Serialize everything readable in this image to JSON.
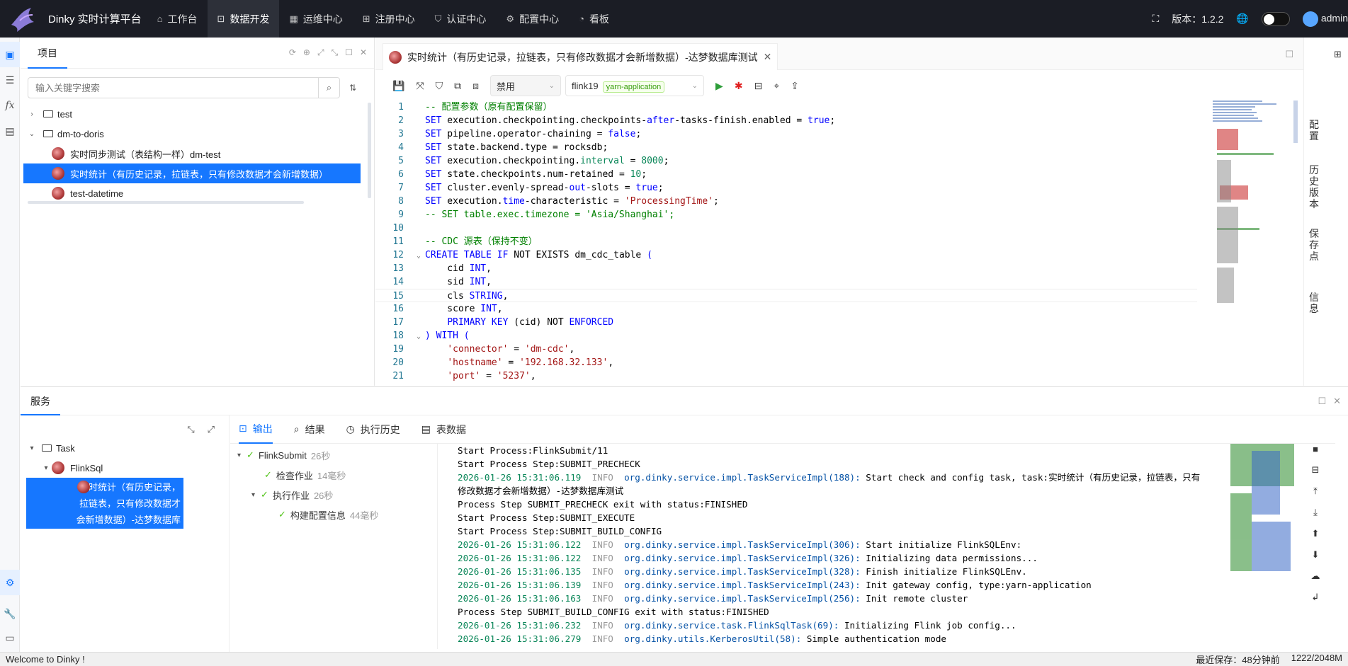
{
  "header": {
    "brand": "Dinky 实时计算平台",
    "nav": [
      {
        "label": "工作台",
        "icon": "home-icon"
      },
      {
        "label": "数据开发",
        "icon": "terminal-icon",
        "active": true
      },
      {
        "label": "运维中心",
        "icon": "calendar-icon"
      },
      {
        "label": "注册中心",
        "icon": "grid-icon"
      },
      {
        "label": "认证中心",
        "icon": "shield-icon"
      },
      {
        "label": "配置中心",
        "icon": "gear-icon"
      },
      {
        "label": "看板",
        "icon": "dashboard-icon"
      }
    ],
    "version": "版本：1.2.2",
    "user": "admin"
  },
  "project": {
    "title": "项目",
    "search_placeholder": "输入关键字搜索",
    "tree": [
      {
        "label": "test",
        "type": "folder",
        "level": 0,
        "caret": "›"
      },
      {
        "label": "dm-to-doris",
        "type": "folder",
        "level": 0,
        "caret": "⌄"
      },
      {
        "label": "实时同步测试（表结构一样）dm-test",
        "type": "task",
        "level": 1
      },
      {
        "label": "实时统计（有历史记录，拉链表，只有修改数据才会新增数据）",
        "type": "task",
        "level": 1,
        "selected": true
      },
      {
        "label": "test-datetime",
        "type": "task",
        "level": 1
      }
    ]
  },
  "editor": {
    "tab_label": "实时统计（有历史记录，拉链表，只有修改数据才会新增数据）-达梦数据库测试",
    "toolbar": {
      "select_label": "禁用",
      "cluster": "flink19",
      "mode_tag": "yarn-application"
    },
    "lines": [
      [
        {
          "c": "cm",
          "t": "-- 配置参数（原有配置保留）"
        }
      ],
      [
        {
          "c": "kw",
          "t": "SET"
        },
        {
          "c": "tx",
          "t": " execution.checkpointing.checkpoints-"
        },
        {
          "c": "kw",
          "t": "after"
        },
        {
          "c": "tx",
          "t": "-tasks-finish.enabled = "
        },
        {
          "c": "kw",
          "t": "true"
        },
        {
          "c": "tx",
          "t": ";"
        }
      ],
      [
        {
          "c": "kw",
          "t": "SET"
        },
        {
          "c": "tx",
          "t": " pipeline.operator-chaining = "
        },
        {
          "c": "kw",
          "t": "false"
        },
        {
          "c": "tx",
          "t": ";"
        }
      ],
      [
        {
          "c": "kw",
          "t": "SET"
        },
        {
          "c": "tx",
          "t": " state.backend.type = rocksdb;"
        }
      ],
      [
        {
          "c": "kw",
          "t": "SET"
        },
        {
          "c": "tx",
          "t": " execution.checkpointing."
        },
        {
          "c": "nu",
          "t": "interval"
        },
        {
          "c": "tx",
          "t": " = "
        },
        {
          "c": "nu",
          "t": "8000"
        },
        {
          "c": "tx",
          "t": ";"
        }
      ],
      [
        {
          "c": "kw",
          "t": "SET"
        },
        {
          "c": "tx",
          "t": " state.checkpoints.num-retained = "
        },
        {
          "c": "nu",
          "t": "10"
        },
        {
          "c": "tx",
          "t": ";"
        }
      ],
      [
        {
          "c": "kw",
          "t": "SET"
        },
        {
          "c": "tx",
          "t": " cluster.evenly-spread-"
        },
        {
          "c": "kw",
          "t": "out"
        },
        {
          "c": "tx",
          "t": "-slots = "
        },
        {
          "c": "kw",
          "t": "true"
        },
        {
          "c": "tx",
          "t": ";"
        }
      ],
      [
        {
          "c": "kw",
          "t": "SET"
        },
        {
          "c": "tx",
          "t": " execution."
        },
        {
          "c": "kw",
          "t": "time"
        },
        {
          "c": "tx",
          "t": "-characteristic = "
        },
        {
          "c": "st",
          "t": "'ProcessingTime'"
        },
        {
          "c": "tx",
          "t": ";"
        }
      ],
      [
        {
          "c": "cm",
          "t": "-- SET table.exec.timezone = 'Asia/Shanghai';"
        }
      ],
      [],
      [
        {
          "c": "cm",
          "t": "-- CDC 源表（保持不变）"
        }
      ],
      [
        {
          "c": "kw",
          "t": "CREATE TABLE IF"
        },
        {
          "c": "tx",
          "t": " NOT EXISTS dm_cdc_table "
        },
        {
          "c": "kw",
          "t": "("
        }
      ],
      [
        {
          "c": "tx",
          "t": "    cid "
        },
        {
          "c": "kw",
          "t": "INT"
        },
        {
          "c": "tx",
          "t": ","
        }
      ],
      [
        {
          "c": "tx",
          "t": "    sid "
        },
        {
          "c": "kw",
          "t": "INT"
        },
        {
          "c": "tx",
          "t": ","
        }
      ],
      [
        {
          "c": "tx",
          "t": "    cls "
        },
        {
          "c": "kw",
          "t": "STRING"
        },
        {
          "c": "tx",
          "t": ","
        }
      ],
      [
        {
          "c": "tx",
          "t": "    score "
        },
        {
          "c": "kw",
          "t": "INT"
        },
        {
          "c": "tx",
          "t": ","
        }
      ],
      [
        {
          "c": "tx",
          "t": "    "
        },
        {
          "c": "kw",
          "t": "PRIMARY KEY"
        },
        {
          "c": "tx",
          "t": " (cid) NOT "
        },
        {
          "c": "kw",
          "t": "ENFORCED"
        }
      ],
      [
        {
          "c": "kw",
          "t": ")"
        },
        {
          "c": "tx",
          "t": " "
        },
        {
          "c": "kw",
          "t": "WITH ("
        }
      ],
      [
        {
          "c": "tx",
          "t": "    "
        },
        {
          "c": "st",
          "t": "'connector'"
        },
        {
          "c": "tx",
          "t": " = "
        },
        {
          "c": "st",
          "t": "'dm-cdc'"
        },
        {
          "c": "tx",
          "t": ","
        }
      ],
      [
        {
          "c": "tx",
          "t": "    "
        },
        {
          "c": "st",
          "t": "'hostname'"
        },
        {
          "c": "tx",
          "t": " = "
        },
        {
          "c": "st",
          "t": "'192.168.32.133'"
        },
        {
          "c": "tx",
          "t": ","
        }
      ],
      [
        {
          "c": "tx",
          "t": "    "
        },
        {
          "c": "st",
          "t": "'port'"
        },
        {
          "c": "tx",
          "t": " = "
        },
        {
          "c": "st",
          "t": "'5237'"
        },
        {
          "c": "tx",
          "t": ","
        }
      ]
    ],
    "line_numbers": [
      "1",
      "2",
      "3",
      "4",
      "5",
      "6",
      "7",
      "8",
      "9",
      "10",
      "11",
      "12",
      "13",
      "14",
      "15",
      "16",
      "17",
      "18",
      "19",
      "20",
      "21"
    ],
    "current_line": 15
  },
  "right_rail": [
    "配置",
    "历史版本",
    "保存点",
    "信息"
  ],
  "service": {
    "title": "服务",
    "tree": [
      {
        "label": "Task",
        "level": 0
      },
      {
        "label": "FlinkSql",
        "level": 1
      },
      {
        "label": "实时统计（有历史记录，拉链表，只有修改数据才会新增数据）-达梦数据库测试",
        "level": 2,
        "selected": true
      }
    ],
    "tabs": [
      {
        "label": "输出",
        "icon": "terminal-icon",
        "active": true
      },
      {
        "label": "结果",
        "icon": "search-icon"
      },
      {
        "label": "执行历史",
        "icon": "history-icon"
      },
      {
        "label": "表数据",
        "icon": "table-icon"
      }
    ],
    "steps": [
      {
        "label": "FlinkSubmit",
        "dur": "26秒",
        "level": 0
      },
      {
        "label": "检查作业",
        "dur": "14毫秒",
        "level": 1
      },
      {
        "label": "执行作业",
        "dur": "26秒",
        "level": 1
      },
      {
        "label": "构建配置信息",
        "dur": "44毫秒",
        "level": 2
      }
    ],
    "log": [
      {
        "plain": "Start Process:FlinkSubmit/11"
      },
      {
        "plain": "Start Process Step:SUBMIT_PRECHECK"
      },
      {
        "d": "2026-01-26 15:31:06.119",
        "lv": "INFO",
        "cls": "org.dinky.service.impl.TaskServiceImpl(188):",
        "msg": " Start check and config task, task:实时统计（有历史记录，拉链表，只有"
      },
      {
        "plain": "修改数据才会新增数据）-达梦数据库测试"
      },
      {
        "plain": "Process Step SUBMIT_PRECHECK exit with status:FINISHED"
      },
      {
        "plain": "Start Process Step:SUBMIT_EXECUTE"
      },
      {
        "plain": "Start Process Step:SUBMIT_BUILD_CONFIG"
      },
      {
        "d": "2026-01-26 15:31:06.122",
        "lv": "INFO",
        "cls": "org.dinky.service.impl.TaskServiceImpl(306):",
        "msg": " Start initialize FlinkSQLEnv:"
      },
      {
        "d": "2026-01-26 15:31:06.122",
        "lv": "INFO",
        "cls": "org.dinky.service.impl.TaskServiceImpl(326):",
        "msg": " Initializing data permissions..."
      },
      {
        "d": "2026-01-26 15:31:06.135",
        "lv": "INFO",
        "cls": "org.dinky.service.impl.TaskServiceImpl(328):",
        "msg": " Finish initialize FlinkSQLEnv."
      },
      {
        "d": "2026-01-26 15:31:06.139",
        "lv": "INFO",
        "cls": "org.dinky.service.impl.TaskServiceImpl(243):",
        "msg": " Init gateway config, type:yarn-application"
      },
      {
        "d": "2026-01-26 15:31:06.163",
        "lv": "INFO",
        "cls": "org.dinky.service.impl.TaskServiceImpl(256):",
        "msg": " Init remote cluster"
      },
      {
        "plain": "Process Step SUBMIT_BUILD_CONFIG exit with status:FINISHED"
      },
      {
        "d": "2026-01-26 15:31:06.232",
        "lv": "INFO",
        "cls": "org.dinky.service.task.FlinkSqlTask(69):",
        "msg": " Initializing Flink job config..."
      },
      {
        "d": "2026-01-26 15:31:06.279",
        "lv": "INFO",
        "cls": "org.dinky.utils.KerberosUtil(58):",
        "msg": " Simple authentication mode"
      }
    ]
  },
  "footer": {
    "welcome": "Welcome to Dinky !",
    "saved": "最近保存：48分钟前",
    "memory": "1222/2048M"
  }
}
